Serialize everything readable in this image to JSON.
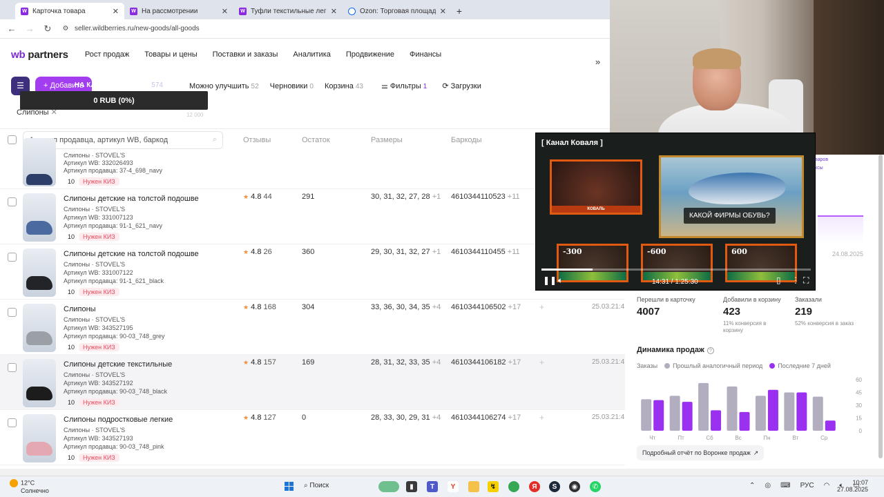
{
  "browser": {
    "tabs": [
      {
        "title": "Карточка товара",
        "icon": "wb"
      },
      {
        "title": "На рассмотрении",
        "icon": "wb"
      },
      {
        "title": "Туфли текстильные легкие в с",
        "icon": "wb"
      },
      {
        "title": "Ozon: Торговая площадка",
        "icon": "ozon"
      }
    ],
    "url": "seller.wildberries.ru/new-goods/all-goods"
  },
  "app": {
    "logo_wb": "wb",
    "logo_partners": "partners",
    "nav": [
      "Рост продаж",
      "Товары и цены",
      "Поставки и заказы",
      "Аналитика",
      "Продвижение",
      "Финансы"
    ]
  },
  "toolbar": {
    "add_label": "Добавить",
    "camera_text": "НА КАМЕРУ В ОФИСЕ",
    "camera_count": "574",
    "filters": [
      {
        "label": "Можно улучшить",
        "count": "52"
      },
      {
        "label": "Черновики",
        "count": "0"
      },
      {
        "label": "Корзина",
        "count": "43"
      }
    ],
    "filters_label": "Фильтры",
    "filters_count": "1",
    "uploads_label": "Загрузки"
  },
  "donation": {
    "bar": "0 RUB (0%)",
    "max": "12 000"
  },
  "chip": "Слипоны",
  "table": {
    "search_placeholder": "Артикул продавца, артикул WB, баркод",
    "headers": [
      "Отзывы",
      "Остаток",
      "Размеры",
      "Баркоды"
    ],
    "partial_row": {
      "brand": "Слипоны · STOVEL'S",
      "wb": "Артикул WB: 332026493",
      "art": "Артикул продавца: 37-4_698_navy",
      "qty": "10",
      "kiz": "Нужен КИЗ"
    },
    "rows": [
      {
        "name": "Слипоны детские на толстой подошве",
        "brand": "Слипоны · STOVEL'S",
        "wb": "Артикул WB: 331007123",
        "art": "Артикул продавца: 91-1_621_navy",
        "qty": "10",
        "kiz": "Нужен КИЗ",
        "rating": "4.8",
        "reviews": "44",
        "stock": "291",
        "sizes": "30, 31, 32, 27, 28",
        "sizes_more": "+1",
        "barcode": "4610344110523",
        "barcode_more": "+11",
        "date": "",
        "color": "#4b6aa0"
      },
      {
        "name": "Слипоны детские на толстой подошве",
        "brand": "Слипоны · STOVEL'S",
        "wb": "Артикул WB: 331007122",
        "art": "Артикул продавца: 91-1_621_black",
        "qty": "10",
        "kiz": "Нужен КИЗ",
        "rating": "4.8",
        "reviews": "26",
        "stock": "360",
        "sizes": "29, 30, 31, 32, 27",
        "sizes_more": "+1",
        "barcode": "4610344110455",
        "barcode_more": "+11",
        "date": "",
        "color": "#222428"
      },
      {
        "name": "Слипоны",
        "brand": "Слипоны · STOVEL'S",
        "wb": "Артикул WB: 343527195",
        "art": "Артикул продавца: 90-03_748_grey",
        "qty": "10",
        "kiz": "Нужен КИЗ",
        "rating": "4.8",
        "reviews": "168",
        "stock": "304",
        "sizes": "33, 36, 30, 34, 35",
        "sizes_more": "+4",
        "barcode": "4610344106502",
        "barcode_more": "+17",
        "date": "25.03.21:4",
        "color": "#9aa0a6"
      },
      {
        "name": "Слипоны детские текстильные",
        "brand": "Слипоны · STOVEL'S",
        "wb": "Артикул WB: 343527192",
        "art": "Артикул продавца: 90-03_748_black",
        "qty": "10",
        "kiz": "Нужен КИЗ",
        "rating": "4.8",
        "reviews": "157",
        "stock": "169",
        "sizes": "28, 31, 32, 33, 35",
        "sizes_more": "+4",
        "barcode": "4610344106182",
        "barcode_more": "+17",
        "date": "25.03.21:4",
        "color": "#1c1c1c"
      },
      {
        "name": "Слипоны подростковые легкие",
        "brand": "Слипоны · STOVEL'S",
        "wb": "Артикул WB: 343527193",
        "art": "Артикул продавца: 90-03_748_pink",
        "qty": "10",
        "kiz": "Нужен КИЗ",
        "rating": "4.8",
        "reviews": "127",
        "stock": "0",
        "sizes": "28, 33, 30, 29, 31",
        "sizes_more": "+4",
        "barcode": "4610344106274",
        "barcode_more": "+17",
        "date": "25.03.21:4",
        "color": "#e3a8b2"
      }
    ]
  },
  "stats": {
    "cards": [
      {
        "label": "Перешли в карточку",
        "value": "4007",
        "sub": ""
      },
      {
        "label": "Добавили в корзину",
        "value": "423",
        "sub": "11% конверсия в корзину"
      },
      {
        "label": "Заказали",
        "value": "219",
        "sub": "52% конверсия в заказ"
      }
    ],
    "date": "24.08.2025",
    "tags": [
      "варов",
      "ксы"
    ]
  },
  "dynamics": {
    "title": "Динамика продаж",
    "legend_orders": "Заказы",
    "legend_prev": "Прошлый аналогичный период",
    "legend_last": "Последние 7 дней",
    "report_btn": "Подробный отчёт по Воронке продаж",
    "colors": {
      "prev": "#b3aebf",
      "last": "#9a30f0"
    }
  },
  "chart_data": {
    "type": "bar",
    "title": "Динамика продаж",
    "categories": [
      "Чт",
      "Пт",
      "Сб",
      "Вс",
      "Пн",
      "Вт",
      "Ср"
    ],
    "series": [
      {
        "name": "Прошлый аналогичный период",
        "values": [
          37,
          41,
          56,
          52,
          41,
          45,
          40
        ]
      },
      {
        "name": "Последние 7 дней",
        "values": [
          36,
          34,
          24,
          22,
          48,
          45,
          12
        ]
      }
    ],
    "y_ticks": [
      "60",
      "45",
      "30",
      "15",
      "0"
    ],
    "ylim": [
      0,
      60
    ]
  },
  "stream": {
    "title": "[ Канал Коваля ]",
    "caption": "КАКОЙ ФИРМЫ ОБУВЬ?",
    "brand_label": "КОВАЛЬ",
    "scores": [
      "-300",
      "-600",
      "600"
    ],
    "time": "14:31 / 1:25:30",
    "progress": 0.19
  },
  "taskbar": {
    "temp": "12°C",
    "weather": "Солнечно",
    "search": "Поиск",
    "lang": "РУС",
    "time": "10:07",
    "date": "27.08.2025"
  }
}
